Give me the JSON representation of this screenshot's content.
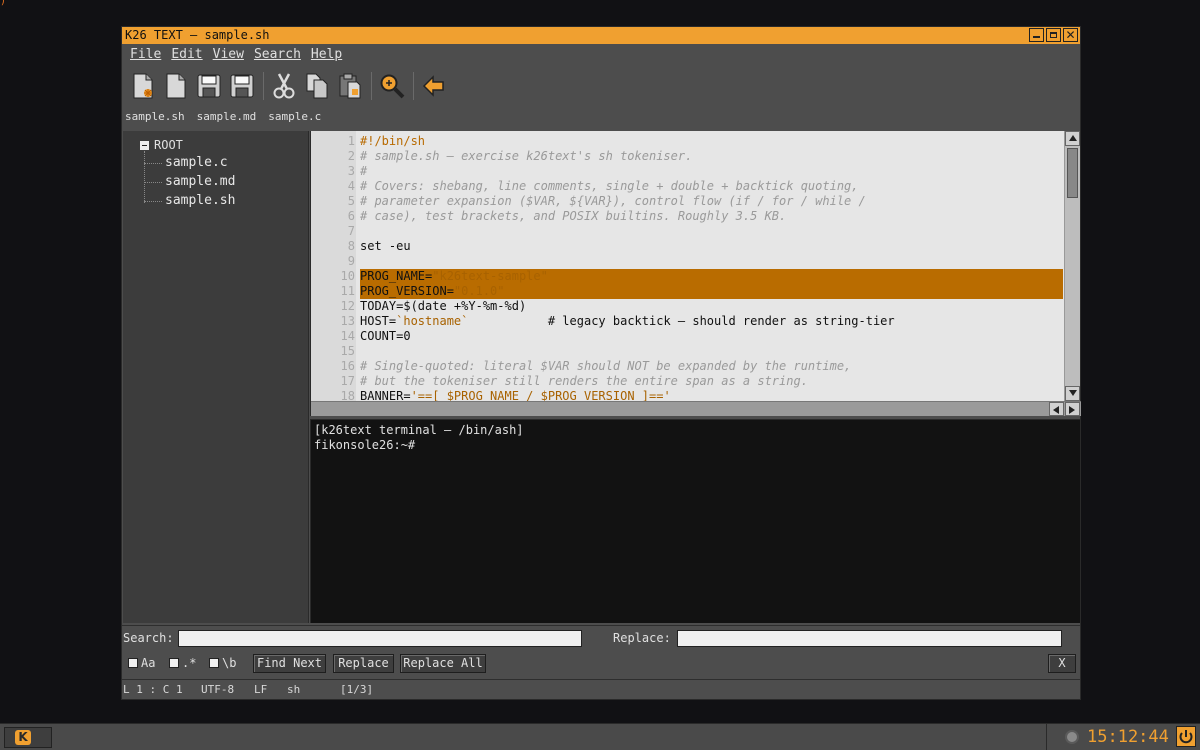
{
  "window": {
    "title": "K26 TEXT — sample.sh"
  },
  "menu": [
    {
      "label": "File"
    },
    {
      "label": "Edit"
    },
    {
      "label": "View"
    },
    {
      "label": "Search"
    },
    {
      "label": "Help"
    }
  ],
  "toolbar": {
    "icons": [
      "new-file-icon",
      "blank-file-icon",
      "save-icon",
      "save-as-icon",
      "cut-icon",
      "copy-icon",
      "paste-icon",
      "search-zoom-icon",
      "back-arrow-icon"
    ]
  },
  "tabs": [
    {
      "label": "sample.sh"
    },
    {
      "label": "sample.md"
    },
    {
      "label": "sample.c"
    }
  ],
  "tree": {
    "root": "ROOT",
    "items": [
      {
        "label": "sample.c"
      },
      {
        "label": "sample.md"
      },
      {
        "label": "sample.sh"
      }
    ]
  },
  "editor": {
    "lines": [
      {
        "n": "1",
        "segs": [
          {
            "t": "#!/bin/sh",
            "k": "sheb"
          }
        ]
      },
      {
        "n": "2",
        "segs": [
          {
            "t": "# sample.sh — exercise k26text's sh tokeniser.",
            "k": "com"
          }
        ]
      },
      {
        "n": "3",
        "segs": [
          {
            "t": "#",
            "k": "com"
          }
        ]
      },
      {
        "n": "4",
        "segs": [
          {
            "t": "# Covers: shebang, line comments, single + double + backtick quoting,",
            "k": "com"
          }
        ]
      },
      {
        "n": "5",
        "segs": [
          {
            "t": "# parameter expansion ($VAR, ${VAR}), control flow (if / for / while /",
            "k": "com"
          }
        ]
      },
      {
        "n": "6",
        "segs": [
          {
            "t": "# case), test brackets, and POSIX builtins. Roughly 3.5 KB.",
            "k": "com"
          }
        ]
      },
      {
        "n": "7",
        "segs": []
      },
      {
        "n": "8",
        "segs": [
          {
            "t": "set -eu",
            "k": "plain"
          }
        ]
      },
      {
        "n": "9",
        "segs": []
      },
      {
        "n": "10",
        "hl": true,
        "segs": [
          {
            "t": "PROG_NAME=",
            "k": "plain"
          },
          {
            "t": "\"k26text-sample\"",
            "k": "plain"
          }
        ]
      },
      {
        "n": "11",
        "hl": true,
        "segs": [
          {
            "t": "PROG_VERSION=",
            "k": "plain"
          },
          {
            "t": "\"0.1.0\"",
            "k": "plain"
          }
        ]
      },
      {
        "n": "12",
        "segs": [
          {
            "t": "TODAY=$(date +%Y-%m-%d)",
            "k": "plain"
          }
        ]
      },
      {
        "n": "13",
        "segs": [
          {
            "t": "HOST=",
            "k": "plain"
          },
          {
            "t": "`hostname`",
            "k": "str"
          },
          {
            "t": "           # legacy backtick — should render as string-tier",
            "k": "plain"
          }
        ]
      },
      {
        "n": "14",
        "segs": [
          {
            "t": "COUNT=0",
            "k": "plain"
          }
        ]
      },
      {
        "n": "15",
        "segs": []
      },
      {
        "n": "16",
        "segs": [
          {
            "t": "# Single-quoted: literal $VAR should NOT be expanded by the runtime,",
            "k": "com"
          }
        ]
      },
      {
        "n": "17",
        "segs": [
          {
            "t": "# but the tokeniser still renders the entire span as a string.",
            "k": "com"
          }
        ]
      },
      {
        "n": "18",
        "segs": [
          {
            "t": "BANNER=",
            "k": "plain"
          },
          {
            "t": "'==[ $PROG_NAME / $PROG_VERSION ]=='",
            "k": "str"
          }
        ]
      }
    ]
  },
  "terminal": {
    "header": "[k26text terminal — /bin/ash]",
    "prompt": "fikonsole26:~#"
  },
  "find": {
    "search_label": "Search:",
    "search_value": "",
    "replace_label": "Replace:",
    "replace_value": "",
    "case_label": "Aa",
    "regex_label": ".*",
    "word_label": "\\b",
    "find_next": "Find Next",
    "replace": "Replace",
    "replace_all": "Replace All",
    "close": "X"
  },
  "status": {
    "position": "L 1 : C 1",
    "encoding": "UTF-8",
    "eol": "LF",
    "lang": "sh",
    "match": "[1/3]"
  },
  "taskbar": {
    "start_label": "K",
    "clock": "15:12:44"
  },
  "colors": {
    "accent": "#f0a030",
    "highlight": "#b96c00",
    "editor_bg": "#e6e6e6"
  }
}
